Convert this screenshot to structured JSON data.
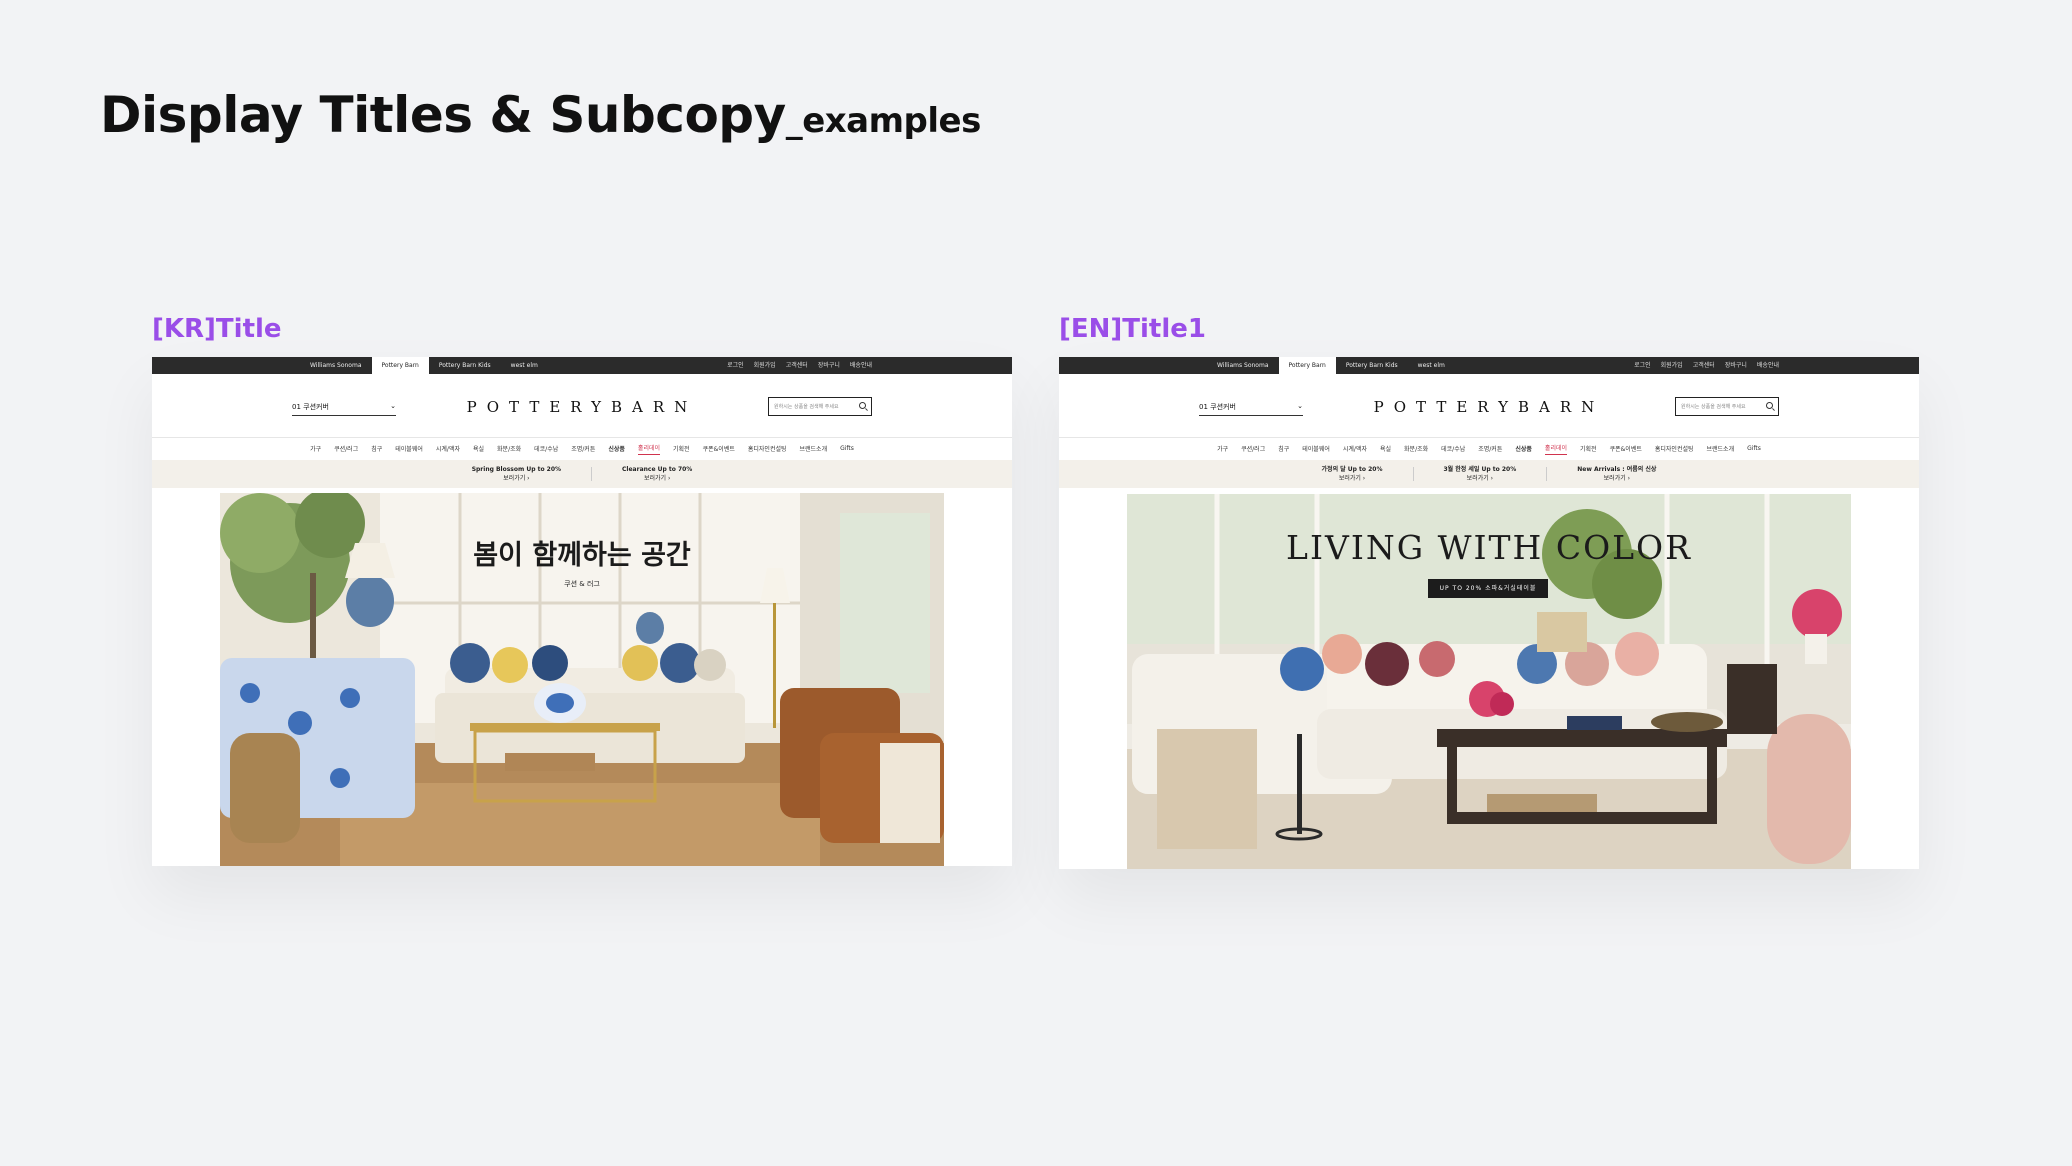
{
  "page": {
    "title": "Display Titles & Subcopy",
    "title_suffix": "_examples"
  },
  "panels": [
    {
      "label": "[KR]Title",
      "topbar": {
        "brands": [
          "Williams Sonoma",
          "Pottery Barn",
          "Pottery Barn Kids",
          "west elm"
        ],
        "active_brand": "Pottery Barn",
        "utility": [
          "로그인",
          "회원가입",
          "고객센터",
          "장바구니",
          "배송안내"
        ]
      },
      "header": {
        "location": "01 쿠션커버",
        "logo": "POTTERYBARN",
        "search_placeholder": "원하시는 상품을 검색해 주세요"
      },
      "nav": [
        "가구",
        "쿠션/러그",
        "침구",
        "테이블웨어",
        "시계/액자",
        "욕실",
        "화분/조화",
        "데코/수납",
        "조명/커튼",
        "신상품",
        "홀리데이",
        "기획전",
        "쿠폰&이벤트",
        "홈디자인컨설팅",
        "브랜드소개",
        "Gifts"
      ],
      "promos": [
        {
          "title": "Spring Blossom Up to 20%",
          "link": "보러가기 ›"
        },
        {
          "title": "Clearance Up to 70%",
          "link": "보러가기 ›"
        }
      ],
      "hero": {
        "title": "봄이 함께하는 공간",
        "subtitle": "쿠션 & 러그"
      }
    },
    {
      "label": "[EN]Title1",
      "topbar": {
        "brands": [
          "Williams Sonoma",
          "Pottery Barn",
          "Pottery Barn Kids",
          "west elm"
        ],
        "active_brand": "Pottery Barn",
        "utility": [
          "로그인",
          "회원가입",
          "고객센터",
          "장바구니",
          "배송안내"
        ]
      },
      "header": {
        "location": "01 쿠션커버",
        "logo": "POTTERYBARN",
        "search_placeholder": "원하시는 상품을 검색해 주세요"
      },
      "nav": [
        "가구",
        "쿠션/러그",
        "침구",
        "테이블웨어",
        "시계/액자",
        "욕실",
        "화분/조화",
        "데코/수납",
        "조명/커튼",
        "신상품",
        "홀리데이",
        "기획전",
        "쿠폰&이벤트",
        "홈디자인컨설팅",
        "브랜드소개",
        "Gifts"
      ],
      "promos": [
        {
          "title": "가정의 달 Up to 20%",
          "link": "보러가기 ›"
        },
        {
          "title": "3월 한정 세일 Up to 20%",
          "link": "보러가기 ›"
        },
        {
          "title": "New Arrivals : 여름의 신상",
          "link": "보러가기 ›"
        }
      ],
      "hero": {
        "title": "LIVING WITH COLOR",
        "button": "UP TO 20% 소파&거실테이블"
      }
    }
  ],
  "colors": {
    "background": "#f2f3f5",
    "label_accent": "#9a4ee8",
    "topbar": "#2b2b2b",
    "promo_bar": "#f3f0ea",
    "nav_highlight": "#d0334e"
  }
}
